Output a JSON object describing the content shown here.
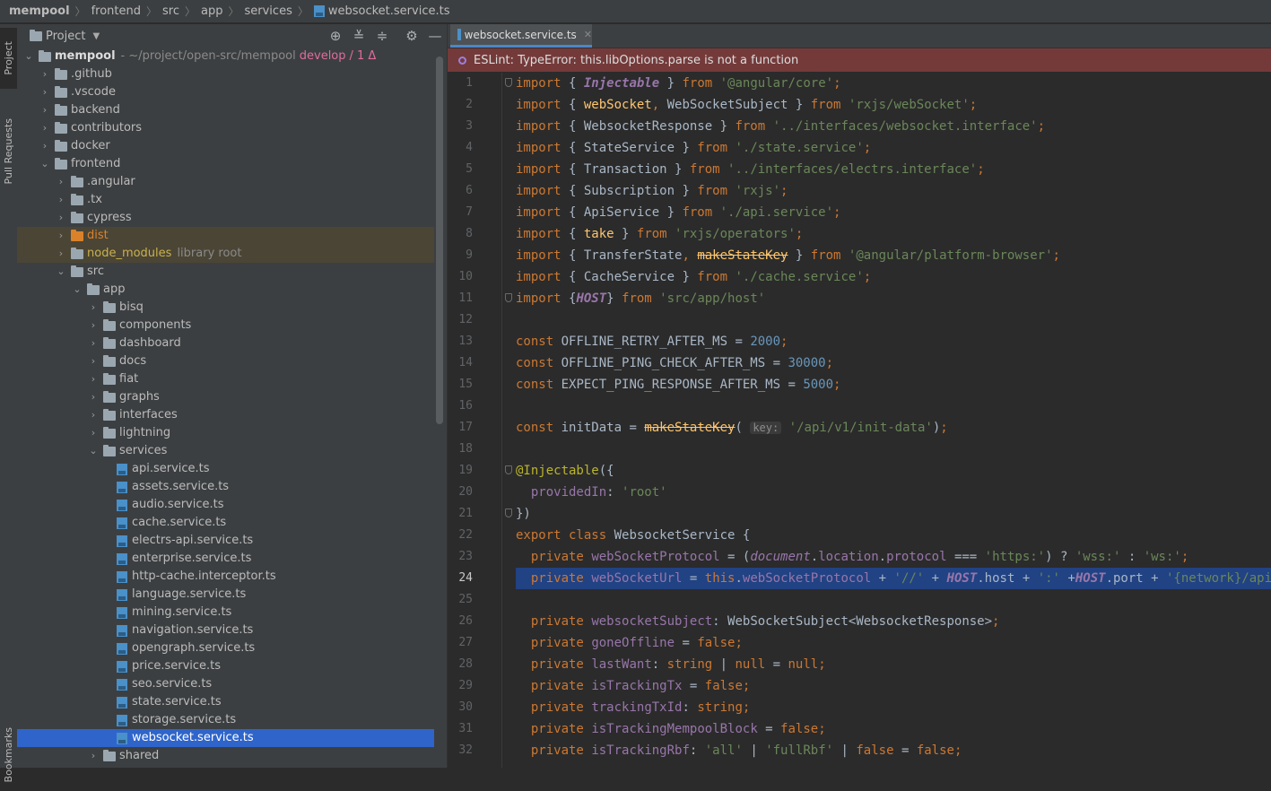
{
  "breadcrumbs": [
    "mempool",
    "frontend",
    "src",
    "app",
    "services",
    "websocket.service.ts"
  ],
  "toolstrip": {
    "project": "Project",
    "pull_requests": "Pull Requests",
    "bookmarks": "Bookmarks"
  },
  "project_panel": {
    "title": "Project",
    "root": {
      "name": "mempool",
      "path": "~/project/open-src/mempool",
      "branch": "develop",
      "changes": "/ 1 Δ"
    },
    "items": [
      {
        "label": ".github",
        "depth": 1,
        "type": "folder",
        "open": false
      },
      {
        "label": ".vscode",
        "depth": 1,
        "type": "folder",
        "open": false
      },
      {
        "label": "backend",
        "depth": 1,
        "type": "folder",
        "open": false
      },
      {
        "label": "contributors",
        "depth": 1,
        "type": "folder",
        "open": false
      },
      {
        "label": "docker",
        "depth": 1,
        "type": "folder",
        "open": false
      },
      {
        "label": "frontend",
        "depth": 1,
        "type": "folder",
        "open": true
      },
      {
        "label": ".angular",
        "depth": 2,
        "type": "folder",
        "open": false
      },
      {
        "label": ".tx",
        "depth": 2,
        "type": "folder",
        "open": false
      },
      {
        "label": "cypress",
        "depth": 2,
        "type": "folder",
        "open": false
      },
      {
        "label": "dist",
        "depth": 2,
        "type": "folder-excluded",
        "open": false
      },
      {
        "label": "node_modules",
        "depth": 2,
        "type": "folder-library",
        "open": false,
        "extra": "library root"
      },
      {
        "label": "src",
        "depth": 2,
        "type": "folder",
        "open": true
      },
      {
        "label": "app",
        "depth": 3,
        "type": "folder",
        "open": true
      },
      {
        "label": "bisq",
        "depth": 4,
        "type": "folder",
        "open": false
      },
      {
        "label": "components",
        "depth": 4,
        "type": "folder",
        "open": false
      },
      {
        "label": "dashboard",
        "depth": 4,
        "type": "folder",
        "open": false
      },
      {
        "label": "docs",
        "depth": 4,
        "type": "folder",
        "open": false
      },
      {
        "label": "fiat",
        "depth": 4,
        "type": "folder",
        "open": false
      },
      {
        "label": "graphs",
        "depth": 4,
        "type": "folder",
        "open": false
      },
      {
        "label": "interfaces",
        "depth": 4,
        "type": "folder",
        "open": false
      },
      {
        "label": "lightning",
        "depth": 4,
        "type": "folder",
        "open": false
      },
      {
        "label": "services",
        "depth": 4,
        "type": "folder",
        "open": true
      },
      {
        "label": "api.service.ts",
        "depth": 5,
        "type": "file"
      },
      {
        "label": "assets.service.ts",
        "depth": 5,
        "type": "file"
      },
      {
        "label": "audio.service.ts",
        "depth": 5,
        "type": "file"
      },
      {
        "label": "cache.service.ts",
        "depth": 5,
        "type": "file"
      },
      {
        "label": "electrs-api.service.ts",
        "depth": 5,
        "type": "file"
      },
      {
        "label": "enterprise.service.ts",
        "depth": 5,
        "type": "file"
      },
      {
        "label": "http-cache.interceptor.ts",
        "depth": 5,
        "type": "file"
      },
      {
        "label": "language.service.ts",
        "depth": 5,
        "type": "file"
      },
      {
        "label": "mining.service.ts",
        "depth": 5,
        "type": "file"
      },
      {
        "label": "navigation.service.ts",
        "depth": 5,
        "type": "file"
      },
      {
        "label": "opengraph.service.ts",
        "depth": 5,
        "type": "file"
      },
      {
        "label": "price.service.ts",
        "depth": 5,
        "type": "file"
      },
      {
        "label": "seo.service.ts",
        "depth": 5,
        "type": "file"
      },
      {
        "label": "state.service.ts",
        "depth": 5,
        "type": "file"
      },
      {
        "label": "storage.service.ts",
        "depth": 5,
        "type": "file"
      },
      {
        "label": "websocket.service.ts",
        "depth": 5,
        "type": "file",
        "selected": true
      },
      {
        "label": "shared",
        "depth": 4,
        "type": "folder",
        "open": false
      }
    ],
    "header_icons": [
      "locate-icon",
      "expand-all-icon",
      "collapse-all-icon",
      "gear-icon",
      "minimize-icon"
    ]
  },
  "editor": {
    "tab_label": "websocket.service.ts",
    "eslint_message": "ESLint: TypeError: this.libOptions.parse is not a function",
    "current_line": 24,
    "lines": [
      {
        "n": "1",
        "fold": true,
        "parts": [
          [
            "kw",
            "import"
          ],
          [
            "dim",
            " { "
          ],
          [
            "imp",
            "Injectable"
          ],
          [
            "dim",
            " } "
          ],
          [
            "kw",
            "from"
          ],
          [
            "dim",
            " "
          ],
          [
            "str",
            "'@angular/core'"
          ],
          [
            "kw",
            ";"
          ]
        ]
      },
      {
        "n": "2",
        "parts": [
          [
            "kw",
            "import"
          ],
          [
            "dim",
            " { "
          ],
          [
            "imp2",
            "webSocket"
          ],
          [
            "kw",
            ","
          ],
          [
            "dim",
            " WebSocketSubject } "
          ],
          [
            "kw",
            "from"
          ],
          [
            "dim",
            " "
          ],
          [
            "str",
            "'rxjs/webSocket'"
          ],
          [
            "kw",
            ";"
          ]
        ]
      },
      {
        "n": "3",
        "parts": [
          [
            "kw",
            "import"
          ],
          [
            "dim",
            " { WebsocketResponse } "
          ],
          [
            "kw",
            "from"
          ],
          [
            "dim",
            " "
          ],
          [
            "str",
            "'../interfaces/websocket.interface'"
          ],
          [
            "kw",
            ";"
          ]
        ]
      },
      {
        "n": "4",
        "parts": [
          [
            "kw",
            "import"
          ],
          [
            "dim",
            " { StateService } "
          ],
          [
            "kw",
            "from"
          ],
          [
            "dim",
            " "
          ],
          [
            "str",
            "'./state.service'"
          ],
          [
            "kw",
            ";"
          ]
        ]
      },
      {
        "n": "5",
        "parts": [
          [
            "kw",
            "import"
          ],
          [
            "dim",
            " { Transaction } "
          ],
          [
            "kw",
            "from"
          ],
          [
            "dim",
            " "
          ],
          [
            "str",
            "'../interfaces/electrs.interface'"
          ],
          [
            "kw",
            ";"
          ]
        ]
      },
      {
        "n": "6",
        "parts": [
          [
            "kw",
            "import"
          ],
          [
            "dim",
            " { Subscription } "
          ],
          [
            "kw",
            "from"
          ],
          [
            "dim",
            " "
          ],
          [
            "str",
            "'rxjs'"
          ],
          [
            "kw",
            ";"
          ]
        ]
      },
      {
        "n": "7",
        "parts": [
          [
            "kw",
            "import"
          ],
          [
            "dim",
            " { ApiService } "
          ],
          [
            "kw",
            "from"
          ],
          [
            "dim",
            " "
          ],
          [
            "str",
            "'./api.service'"
          ],
          [
            "kw",
            ";"
          ]
        ]
      },
      {
        "n": "8",
        "parts": [
          [
            "kw",
            "import"
          ],
          [
            "dim",
            " { "
          ],
          [
            "imp2",
            "take"
          ],
          [
            "dim",
            " } "
          ],
          [
            "kw",
            "from"
          ],
          [
            "dim",
            " "
          ],
          [
            "str",
            "'rxjs/operators'"
          ],
          [
            "kw",
            ";"
          ]
        ]
      },
      {
        "n": "9",
        "parts": [
          [
            "kw",
            "import"
          ],
          [
            "dim",
            " { TransferState"
          ],
          [
            "kw",
            ","
          ],
          [
            "dim",
            " "
          ],
          [
            "strike",
            "makeStateKey"
          ],
          [
            "dim",
            " } "
          ],
          [
            "kw",
            "from"
          ],
          [
            "dim",
            " "
          ],
          [
            "str",
            "'@angular/platform-browser'"
          ],
          [
            "kw",
            ";"
          ]
        ]
      },
      {
        "n": "10",
        "parts": [
          [
            "kw",
            "import"
          ],
          [
            "dim",
            " { CacheService } "
          ],
          [
            "kw",
            "from"
          ],
          [
            "dim",
            " "
          ],
          [
            "str",
            "'./cache.service'"
          ],
          [
            "kw",
            ";"
          ]
        ]
      },
      {
        "n": "11",
        "fold": true,
        "parts": [
          [
            "kw",
            "import"
          ],
          [
            "dim",
            " {"
          ],
          [
            "imp",
            "HOST"
          ],
          [
            "dim",
            "} "
          ],
          [
            "kw",
            "from"
          ],
          [
            "dim",
            " "
          ],
          [
            "str",
            "'src/app/host'"
          ]
        ]
      },
      {
        "n": "12",
        "parts": []
      },
      {
        "n": "13",
        "parts": [
          [
            "kw",
            "const"
          ],
          [
            "dim",
            " OFFLINE_RETRY_AFTER_MS = "
          ],
          [
            "num",
            "2000"
          ],
          [
            "kw",
            ";"
          ]
        ]
      },
      {
        "n": "14",
        "parts": [
          [
            "kw",
            "const"
          ],
          [
            "dim",
            " OFFLINE_PING_CHECK_AFTER_MS = "
          ],
          [
            "num",
            "30000"
          ],
          [
            "kw",
            ";"
          ]
        ]
      },
      {
        "n": "15",
        "parts": [
          [
            "kw",
            "const"
          ],
          [
            "dim",
            " EXPECT_PING_RESPONSE_AFTER_MS = "
          ],
          [
            "num",
            "5000"
          ],
          [
            "kw",
            ";"
          ]
        ]
      },
      {
        "n": "16",
        "parts": []
      },
      {
        "n": "17",
        "parts": [
          [
            "kw",
            "const"
          ],
          [
            "dim",
            " initData = "
          ],
          [
            "strike",
            "makeStateKey"
          ],
          [
            "dim",
            "( "
          ],
          [
            "hint",
            "key:"
          ],
          [
            "dim",
            " "
          ],
          [
            "str",
            "'/api/v1/init-data'"
          ],
          [
            "dim",
            ")"
          ],
          [
            "kw",
            ";"
          ]
        ]
      },
      {
        "n": "18",
        "parts": []
      },
      {
        "n": "19",
        "fold": true,
        "parts": [
          [
            "deco",
            "@Injectable"
          ],
          [
            "dim",
            "({"
          ]
        ]
      },
      {
        "n": "20",
        "parts": [
          [
            "dim",
            "  "
          ],
          [
            "fld",
            "providedIn"
          ],
          [
            "dim",
            ": "
          ],
          [
            "str",
            "'root'"
          ]
        ]
      },
      {
        "n": "21",
        "fold": true,
        "parts": [
          [
            "dim",
            "})"
          ]
        ]
      },
      {
        "n": "22",
        "parts": [
          [
            "kw",
            "export class"
          ],
          [
            "dim",
            " WebsocketService {"
          ]
        ]
      },
      {
        "n": "23",
        "parts": [
          [
            "dim",
            "  "
          ],
          [
            "kw",
            "private"
          ],
          [
            "dim",
            " "
          ],
          [
            "fld",
            "webSocketProtocol"
          ],
          [
            "dim",
            " = ("
          ],
          [
            "glob",
            "document"
          ],
          [
            "dim",
            "."
          ],
          [
            "fld",
            "location"
          ],
          [
            "dim",
            "."
          ],
          [
            "fld",
            "protocol"
          ],
          [
            "dim",
            " === "
          ],
          [
            "str",
            "'https:'"
          ],
          [
            "dim",
            ") ? "
          ],
          [
            "str",
            "'wss:'"
          ],
          [
            "dim",
            " : "
          ],
          [
            "str",
            "'ws:'"
          ],
          [
            "kw",
            ";"
          ]
        ]
      },
      {
        "n": "24",
        "parts": [
          [
            "dim",
            "  "
          ],
          [
            "kw",
            "private"
          ],
          [
            "dim",
            " "
          ],
          [
            "fld",
            "webSocketUrl"
          ],
          [
            "dim",
            " = "
          ],
          [
            "kw",
            "this"
          ],
          [
            "dim",
            "."
          ],
          [
            "fld",
            "webSocketProtocol"
          ],
          [
            "dim",
            " + "
          ],
          [
            "str",
            "'//'"
          ],
          [
            "dim",
            " + "
          ],
          [
            "imp",
            "HOST"
          ],
          [
            "dim",
            ".host + "
          ],
          [
            "str",
            "':'"
          ],
          [
            "dim",
            " +"
          ],
          [
            "imp",
            "HOST"
          ],
          [
            "dim",
            ".port + "
          ],
          [
            "str",
            "'{network}/api"
          ]
        ]
      },
      {
        "n": "25",
        "parts": []
      },
      {
        "n": "26",
        "parts": [
          [
            "dim",
            "  "
          ],
          [
            "kw",
            "private"
          ],
          [
            "dim",
            " "
          ],
          [
            "fld",
            "websocketSubject"
          ],
          [
            "dim",
            ": WebSocketSubject<WebsocketResponse>"
          ],
          [
            "kw",
            ";"
          ]
        ]
      },
      {
        "n": "27",
        "parts": [
          [
            "dim",
            "  "
          ],
          [
            "kw",
            "private"
          ],
          [
            "dim",
            " "
          ],
          [
            "fld",
            "goneOffline"
          ],
          [
            "dim",
            " = "
          ],
          [
            "kw",
            "false;"
          ]
        ]
      },
      {
        "n": "28",
        "parts": [
          [
            "dim",
            "  "
          ],
          [
            "kw",
            "private"
          ],
          [
            "dim",
            " "
          ],
          [
            "fld",
            "lastWant"
          ],
          [
            "dim",
            ": "
          ],
          [
            "kw",
            "string"
          ],
          [
            "dim",
            " | "
          ],
          [
            "kw",
            "null"
          ],
          [
            "dim",
            " = "
          ],
          [
            "kw",
            "null;"
          ]
        ]
      },
      {
        "n": "29",
        "parts": [
          [
            "dim",
            "  "
          ],
          [
            "kw",
            "private"
          ],
          [
            "dim",
            " "
          ],
          [
            "fld",
            "isTrackingTx"
          ],
          [
            "dim",
            " = "
          ],
          [
            "kw",
            "false;"
          ]
        ]
      },
      {
        "n": "30",
        "parts": [
          [
            "dim",
            "  "
          ],
          [
            "kw",
            "private"
          ],
          [
            "dim",
            " "
          ],
          [
            "fld",
            "trackingTxId"
          ],
          [
            "dim",
            ": "
          ],
          [
            "kw",
            "string;"
          ]
        ]
      },
      {
        "n": "31",
        "parts": [
          [
            "dim",
            "  "
          ],
          [
            "kw",
            "private"
          ],
          [
            "dim",
            " "
          ],
          [
            "fld",
            "isTrackingMempoolBlock"
          ],
          [
            "dim",
            " = "
          ],
          [
            "kw",
            "false;"
          ]
        ]
      },
      {
        "n": "32",
        "parts": [
          [
            "dim",
            "  "
          ],
          [
            "kw",
            "private"
          ],
          [
            "dim",
            " "
          ],
          [
            "fld",
            "isTrackingRbf"
          ],
          [
            "dim",
            ": "
          ],
          [
            "str",
            "'all'"
          ],
          [
            "dim",
            " | "
          ],
          [
            "str",
            "'fullRbf'"
          ],
          [
            "dim",
            " | "
          ],
          [
            "kw",
            "false"
          ],
          [
            "dim",
            " = "
          ],
          [
            "kw",
            "false;"
          ]
        ]
      }
    ]
  }
}
